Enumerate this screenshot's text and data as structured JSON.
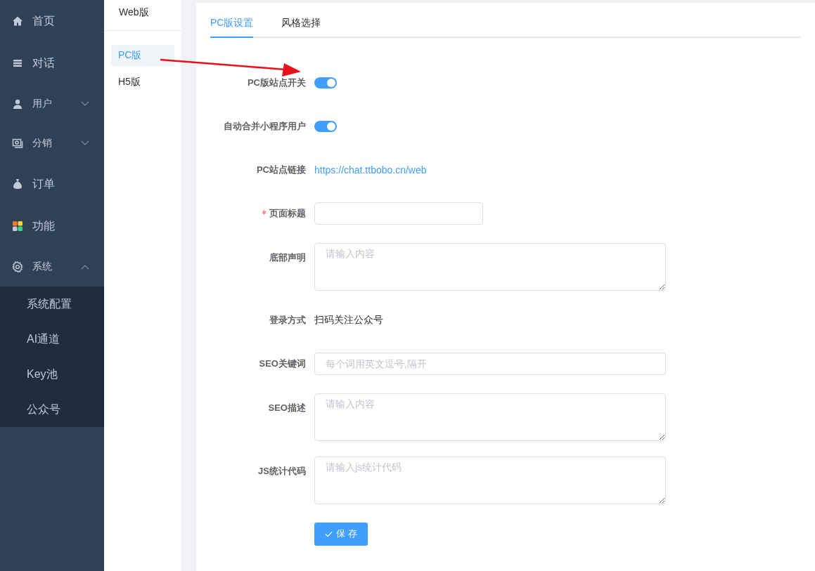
{
  "sidebar": {
    "items": [
      {
        "label": "首页",
        "kind": "link"
      },
      {
        "label": "对话",
        "kind": "link"
      },
      {
        "label": "用户",
        "kind": "group",
        "expanded": false
      },
      {
        "label": "分销",
        "kind": "group",
        "expanded": false
      },
      {
        "label": "订单",
        "kind": "link"
      },
      {
        "label": "功能",
        "kind": "link"
      },
      {
        "label": "系统",
        "kind": "group",
        "expanded": true,
        "children": [
          {
            "label": "系统配置"
          },
          {
            "label": "AI通道"
          },
          {
            "label": "Key池"
          },
          {
            "label": "公众号"
          }
        ]
      }
    ]
  },
  "subnav": {
    "title": "Web版",
    "items": [
      {
        "label": "PC版",
        "selected": true
      },
      {
        "label": "H5版",
        "selected": false
      }
    ]
  },
  "tabs": [
    {
      "label": "PC版设置",
      "selected": true
    },
    {
      "label": "风格选择",
      "selected": false
    }
  ],
  "form": {
    "rows": [
      {
        "kind": "switch",
        "label": "PC版站点开关",
        "on": true
      },
      {
        "kind": "switch",
        "label": "自动合并小程序用户",
        "on": true
      },
      {
        "kind": "link",
        "label": "PC站点链接",
        "value": "https://chat.ttbobo.cn/web"
      },
      {
        "kind": "input",
        "label": "页面标题",
        "required": true
      },
      {
        "kind": "textarea",
        "label": "底部声明",
        "placeholder": "请输入内容"
      },
      {
        "kind": "static",
        "label": "登录方式",
        "value": "扫码关注公众号"
      },
      {
        "kind": "input",
        "label": "SEO关键词",
        "placeholder": "每个词用英文逗号,隔开"
      },
      {
        "kind": "textarea",
        "label": "SEO描述",
        "placeholder": "请输入内容"
      },
      {
        "kind": "textarea",
        "label": "JS统计代码",
        "placeholder": "请输入js统计代码"
      }
    ],
    "save_button": "保 存"
  },
  "annotation": {
    "kind": "arrow"
  }
}
